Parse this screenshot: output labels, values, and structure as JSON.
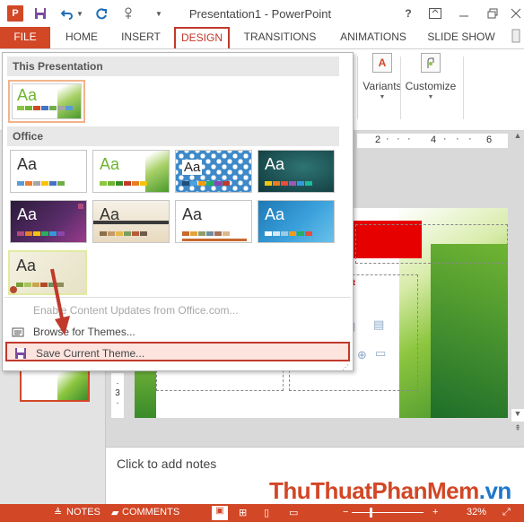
{
  "titlebar": {
    "app_icon": "P",
    "title": "Presentation1 - PowerPoint",
    "help": "?"
  },
  "tabs": [
    {
      "id": "file",
      "label": "FILE"
    },
    {
      "id": "home",
      "label": "HOME"
    },
    {
      "id": "insert",
      "label": "INSERT"
    },
    {
      "id": "design",
      "label": "DESIGN",
      "active": true
    },
    {
      "id": "transitions",
      "label": "TRANSITIONS"
    },
    {
      "id": "animations",
      "label": "ANIMATIONS"
    },
    {
      "id": "slideshow",
      "label": "SLIDE SHOW"
    }
  ],
  "ribbon": {
    "variants_label": "Variants",
    "customize_label": "Customize"
  },
  "gallery": {
    "this_presentation_label": "This Presentation",
    "office_label": "Office",
    "aa_text": "Aa",
    "menu": {
      "enable_updates": "Enable Content Updates from Office.com...",
      "browse_themes": "Browse for Themes...",
      "save_theme": "Save Current Theme..."
    }
  },
  "ruler": {
    "h_marks": [
      "2",
      "4",
      "6"
    ],
    "v_mark": "3"
  },
  "slide": {
    "content_label": "xt"
  },
  "notes": {
    "placeholder": "Click to add notes"
  },
  "statusbar": {
    "notes_label": "NOTES",
    "comments_label": "COMMENTS",
    "zoom_level": "32%",
    "accent": "#d24726"
  },
  "watermark": {
    "part1": "ThuThuat",
    "part2": "PhanMem",
    "part3": ".vn"
  }
}
